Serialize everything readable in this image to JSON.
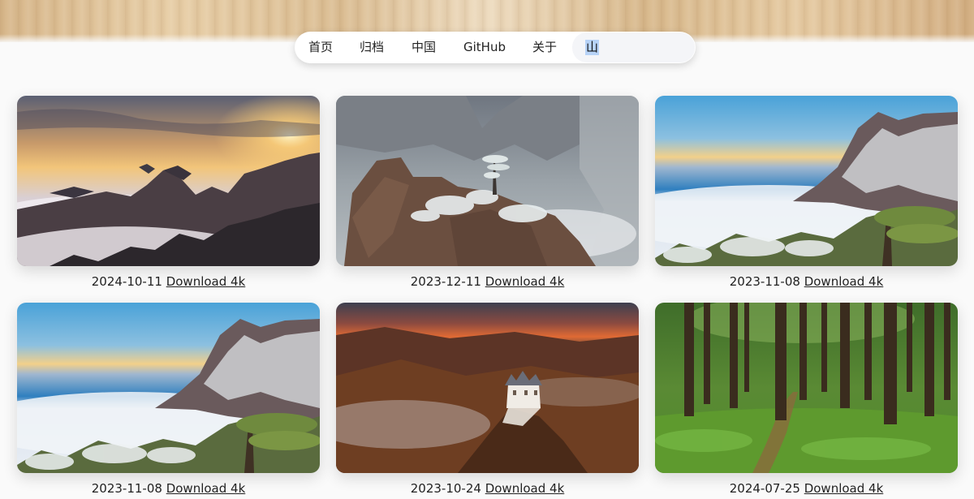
{
  "nav": {
    "items": [
      {
        "label": "首页"
      },
      {
        "label": "归档"
      },
      {
        "label": "中国"
      },
      {
        "label": "GitHub"
      },
      {
        "label": "关于"
      }
    ],
    "search_value": "山"
  },
  "gallery": [
    {
      "date": "2024-10-11",
      "download_label": "Download 4k"
    },
    {
      "date": "2023-12-11",
      "download_label": "Download 4k"
    },
    {
      "date": "2023-11-08",
      "download_label": "Download 4k"
    },
    {
      "date": "2023-11-08",
      "download_label": "Download 4k"
    },
    {
      "date": "2023-10-24",
      "download_label": "Download 4k"
    },
    {
      "date": "2024-07-25",
      "download_label": "Download 4k"
    }
  ]
}
